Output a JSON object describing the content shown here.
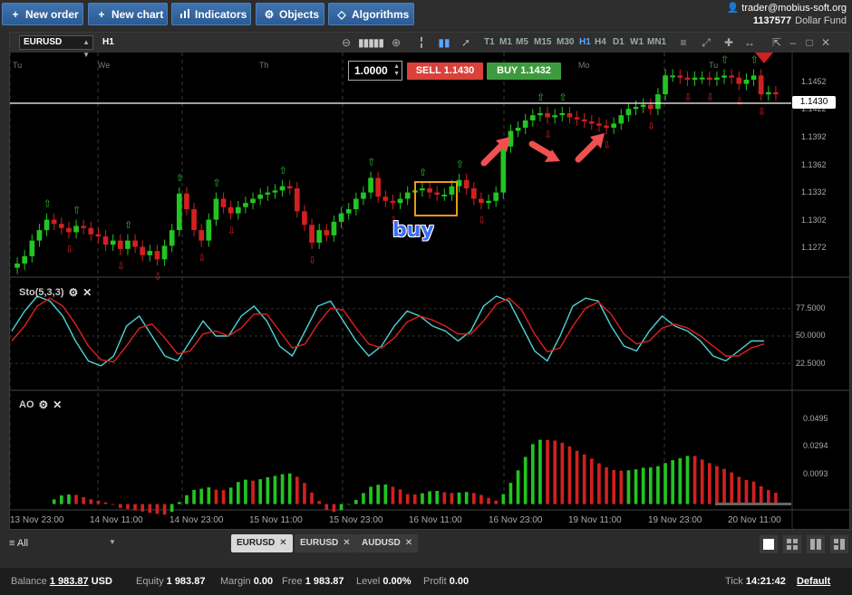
{
  "toolbar": {
    "new_order": "New order",
    "new_chart": "New chart",
    "indicators": "Indicators",
    "objects": "Objects",
    "algorithms": "Algorithms"
  },
  "account": {
    "user": "trader@mobius-soft.org",
    "number": "1137577",
    "fund": "Dollar Fund"
  },
  "chart_header": {
    "symbol": "EURUSD",
    "timeframe": "H1",
    "timeframes": [
      "T1",
      "M1",
      "M5",
      "M15",
      "M30",
      "H1",
      "H4",
      "D1",
      "W1",
      "MN1"
    ],
    "active_timeframe": "H1"
  },
  "trade_panel": {
    "quantity": "1.0000",
    "sell_label": "SELL 1.1430",
    "buy_label": "BUY 1.1432"
  },
  "annotation": {
    "buy_text": "buy"
  },
  "price_tag": "1.1430",
  "main_panel": {
    "day_labels": [
      "Tu",
      "We",
      "Th",
      "Mo",
      "Tu"
    ],
    "price_ticks": [
      "1.1452",
      "1.1422",
      "1.1392",
      "1.1362",
      "1.1332",
      "1.1302",
      "1.1272"
    ]
  },
  "stoch_panel": {
    "title": "Sto(5,3,3)",
    "ticks": [
      "77.5000",
      "50.0000",
      "22.5000"
    ]
  },
  "ao_panel": {
    "title": "AO",
    "ticks": [
      "0.0495",
      "0.0294",
      "0.0093"
    ]
  },
  "time_axis": [
    "13 Nov 23:00",
    "14 Nov 11:00",
    "14 Nov 23:00",
    "15 Nov 11:00",
    "15 Nov 23:00",
    "16 Nov 11:00",
    "16 Nov 23:00",
    "19 Nov 11:00",
    "19 Nov 23:00",
    "20 Nov 11:00"
  ],
  "tabs": {
    "filter": "All",
    "symbols": [
      "EURUSD",
      "EURUSD",
      "AUDUSD"
    ]
  },
  "status": {
    "balance_label": "Balance",
    "balance": "1 983.87",
    "currency": "USD",
    "equity_label": "Equity",
    "equity": "1 983.87",
    "margin_label": "Margin",
    "margin": "0.00",
    "free_label": "Free",
    "free": "1 983.87",
    "level_label": "Level",
    "level": "0.00%",
    "profit_label": "Profit",
    "profit": "0.00",
    "tick_label": "Tick",
    "tick": "14:21:42",
    "profile": "Default"
  },
  "colors": {
    "up_candle": "#22c522",
    "down_candle": "#d12020",
    "stoch_main": "#4fd2d2",
    "stoch_signal": "#e02020",
    "accent": "#3f74b0"
  },
  "chart_data": [
    {
      "type": "candlestick",
      "symbol": "EURUSD",
      "timeframe": "H1",
      "ylim": [
        1.1255,
        1.147
      ],
      "current_price": 1.143,
      "closes": [
        1.1268,
        1.1275,
        1.129,
        1.13,
        1.131,
        1.1306,
        1.1302,
        1.1298,
        1.1304,
        1.1302,
        1.1296,
        1.1294,
        1.1286,
        1.129,
        1.1282,
        1.129,
        1.1284,
        1.1276,
        1.128,
        1.1272,
        1.1285,
        1.13,
        1.1335,
        1.132,
        1.13,
        1.129,
        1.131,
        1.133,
        1.1322,
        1.1316,
        1.1322,
        1.1326,
        1.133,
        1.1334,
        1.1336,
        1.1338,
        1.1342,
        1.134,
        1.1318,
        1.1305,
        1.1288,
        1.13,
        1.1295,
        1.1308,
        1.1316,
        1.132,
        1.133,
        1.1336,
        1.135,
        1.1332,
        1.1328,
        1.1326,
        1.133,
        1.1336,
        1.1338,
        1.134,
        1.1336,
        1.1334,
        1.1334,
        1.1342,
        1.1348,
        1.134,
        1.133,
        1.1326,
        1.1328,
        1.1336,
        1.138,
        1.1395,
        1.1398,
        1.1405,
        1.141,
        1.1412,
        1.1408,
        1.141,
        1.1412,
        1.1408,
        1.1406,
        1.1404,
        1.1402,
        1.14,
        1.1398,
        1.1402,
        1.141,
        1.1416,
        1.1418,
        1.142,
        1.1416,
        1.143,
        1.1448,
        1.1448,
        1.1446,
        1.1444,
        1.1446,
        1.1446,
        1.1444,
        1.1446,
        1.1448,
        1.1446,
        1.144,
        1.1444,
        1.1448,
        1.143,
        1.1432,
        1.143
      ],
      "stochastic": {
        "ylim": [
          0,
          100
        ],
        "levels": [
          77.5,
          50,
          22.5
        ],
        "k": [
          55,
          75,
          90,
          85,
          70,
          45,
          25,
          20,
          30,
          60,
          70,
          50,
          30,
          25,
          45,
          65,
          50,
          50,
          70,
          80,
          65,
          40,
          30,
          55,
          80,
          85,
          65,
          45,
          30,
          40,
          60,
          75,
          70,
          60,
          55,
          45,
          55,
          80,
          90,
          85,
          60,
          35,
          25,
          50,
          80,
          88,
          85,
          60,
          40,
          35,
          55,
          70,
          60,
          55,
          45,
          30,
          25,
          35,
          45,
          45
        ],
        "d": [
          45,
          60,
          80,
          88,
          80,
          62,
          40,
          26,
          24,
          40,
          58,
          62,
          48,
          32,
          35,
          52,
          55,
          50,
          58,
          72,
          72,
          55,
          38,
          42,
          62,
          78,
          76,
          58,
          42,
          38,
          48,
          64,
          70,
          66,
          60,
          52,
          52,
          65,
          82,
          88,
          76,
          52,
          34,
          38,
          60,
          78,
          84,
          72,
          52,
          42,
          45,
          58,
          62,
          58,
          50,
          40,
          30,
          30,
          38,
          42
        ]
      },
      "awesome_oscillator": {
        "ylim": [
          -0.002,
          0.056
        ],
        "levels": [
          0.0495,
          0.0294,
          0.0093
        ]
      }
    }
  ]
}
